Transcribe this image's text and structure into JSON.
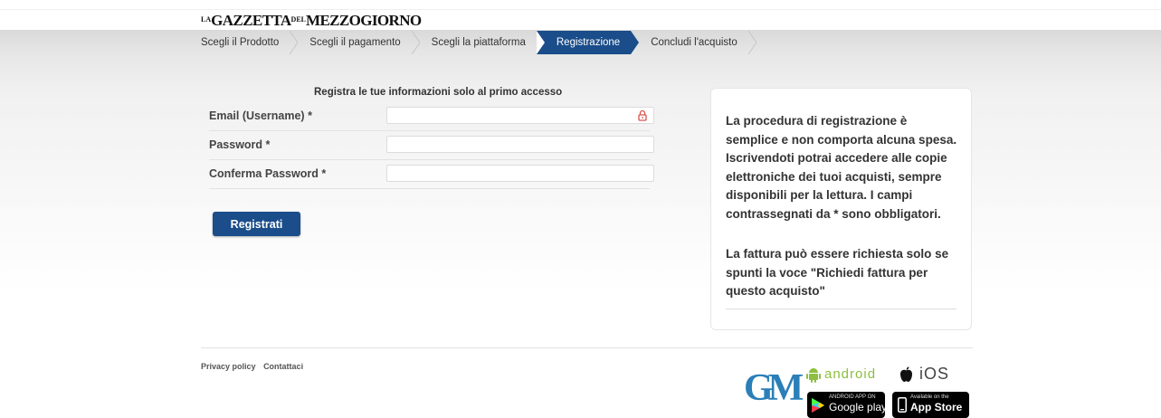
{
  "header": {
    "logo": {
      "prefix": "LA",
      "part1": "GAZZETTA",
      "mid": "DEL",
      "part2": "MEZZOGIORNO"
    }
  },
  "steps": [
    {
      "label": "Scegli il Prodotto",
      "active": false
    },
    {
      "label": "Scegli il pagamento",
      "active": false
    },
    {
      "label": "Scegli la piattaforma",
      "active": false
    },
    {
      "label": "Registrazione",
      "active": true
    },
    {
      "label": "Concludi l'acquisto",
      "active": false
    }
  ],
  "form": {
    "title": "Registra le tue informazioni solo al primo accesso",
    "email_label": "Email (Username) *",
    "email_value": "",
    "password_label": "Password *",
    "password_value": "",
    "confirm_label": "Conferma Password *",
    "confirm_value": "",
    "submit_label": "Registrati"
  },
  "info": {
    "paragraph1": "La procedura di registrazione è semplice e non comporta alcuna spesa. Iscrivendoti potrai accedere alle copie elettroniche dei tuoi acquisti, sempre disponibili per la lettura. I campi contrassegnati da * sono obbligatori.",
    "paragraph2": "La fattura può essere richiesta solo se spunti la voce \"Richiedi fattura per questo acquisto\""
  },
  "footer": {
    "privacy": "Privacy policy",
    "contact": "Contattaci",
    "gm_logo": "GM",
    "android_label": "android",
    "ios_label": "iOS",
    "google_play": {
      "small": "ANDROID APP ON",
      "big": "Google play"
    },
    "app_store": {
      "small": "Available on the",
      "big": "App Store"
    }
  },
  "colors": {
    "accent": "#1a4d8a",
    "gm_blue": "#2b7fb8",
    "android_green": "#8cbf3f"
  }
}
